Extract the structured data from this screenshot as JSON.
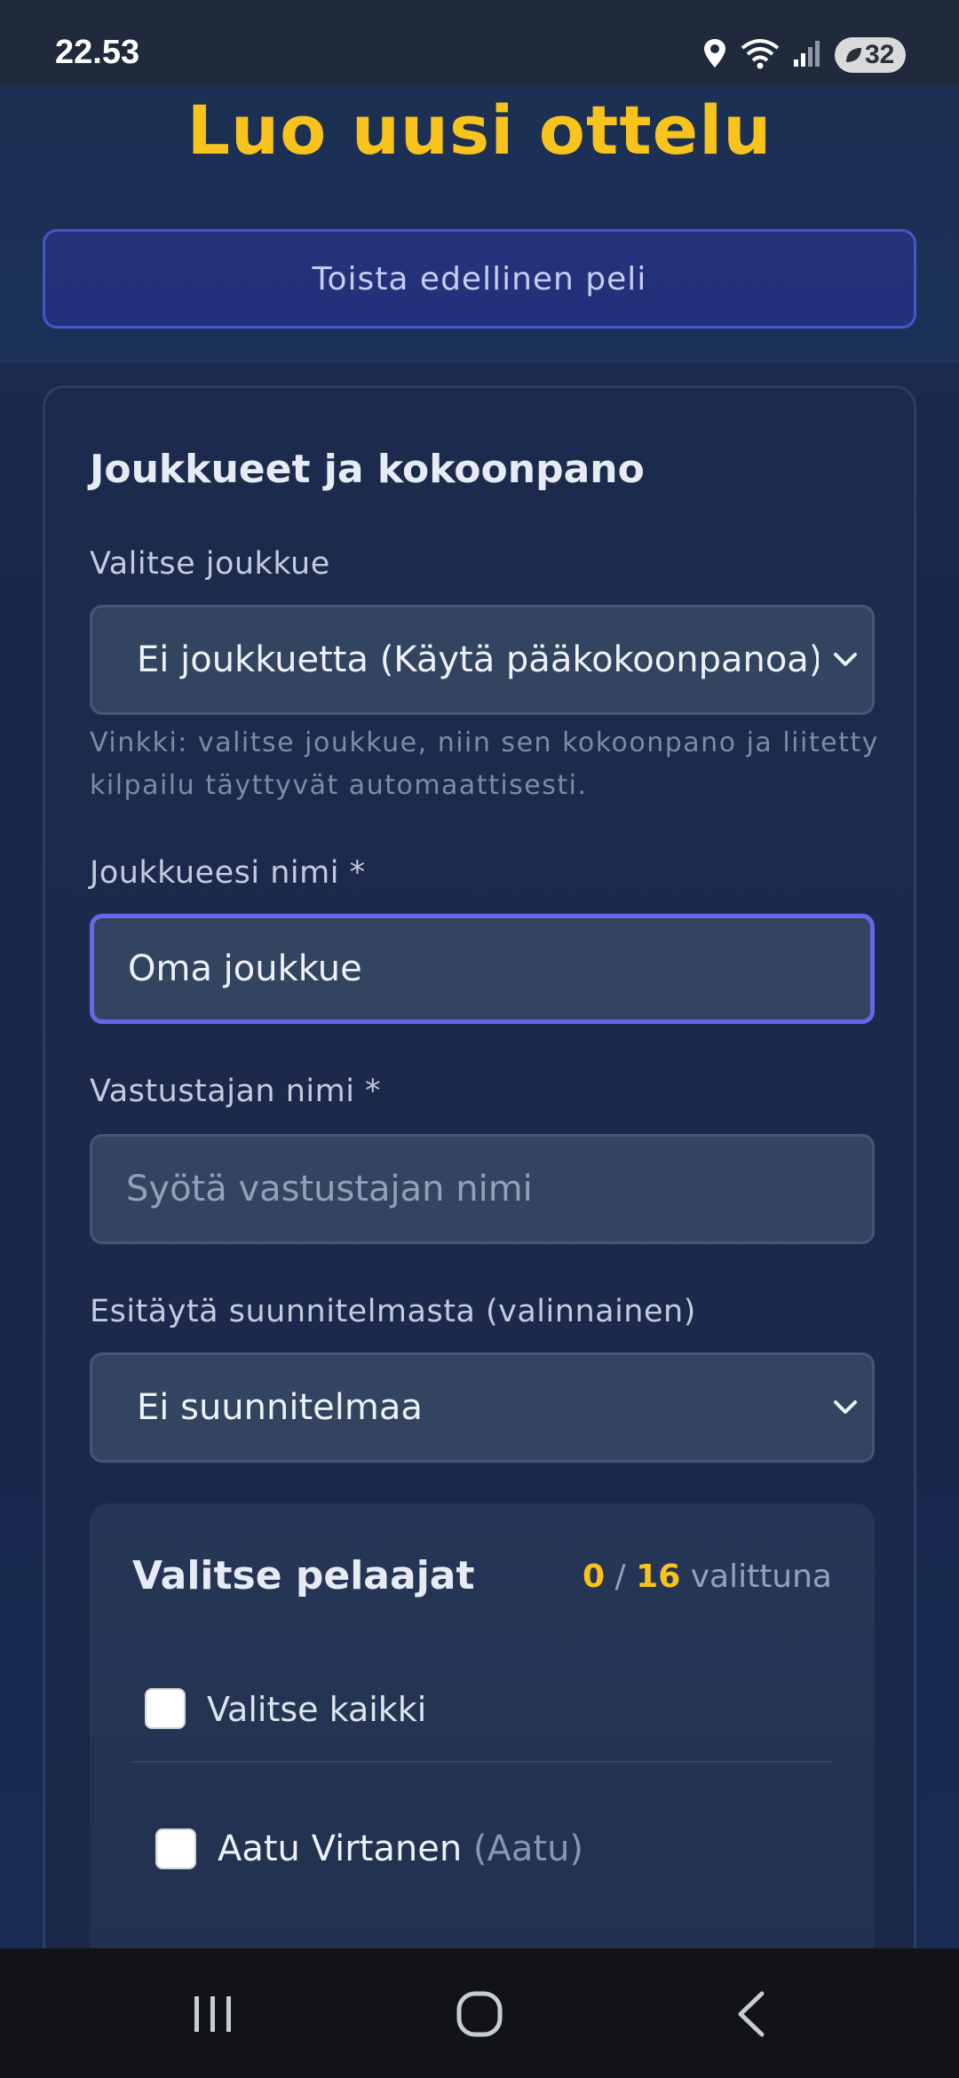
{
  "status_bar": {
    "time": "22.53",
    "battery": "32",
    "icons": [
      "location-icon",
      "wifi-icon",
      "signal-icon",
      "battery-icon"
    ]
  },
  "header": {
    "title": "Luo uusi ottelu",
    "replay_button": "Toista edellinen peli"
  },
  "form": {
    "section_title": "Joukkueet ja kokoonpano",
    "team_select": {
      "label": "Valitse joukkue",
      "value": "Ei joukkuetta (Käytä pääkokoonpanoa)",
      "hint": "Vinkki: valitse joukkue, niin sen kokoonpano ja liitetty kilpailu täyttyvät automaattisesti."
    },
    "team_name": {
      "label": "Joukkueesi nimi *",
      "value": "Oma joukkue"
    },
    "opponent_name": {
      "label": "Vastustajan nimi *",
      "placeholder": "Syötä vastustajan nimi"
    },
    "plan_select": {
      "label": "Esitäytä suunnitelmasta (valinnainen)",
      "value": "Ei suunnitelmaa"
    }
  },
  "players": {
    "title": "Valitse pelaajat",
    "selected_count": "0",
    "separator": "/",
    "total_count": "16",
    "count_suffix": "valittuna",
    "select_all_label": "Valitse kaikki",
    "list": [
      {
        "name": "Aatu Virtanen",
        "nickname": "(Aatu)"
      }
    ]
  },
  "colors": {
    "accent_yellow": "#f7c31c",
    "focus_border": "#6866e8",
    "replay_button_bg": "#25337a"
  }
}
